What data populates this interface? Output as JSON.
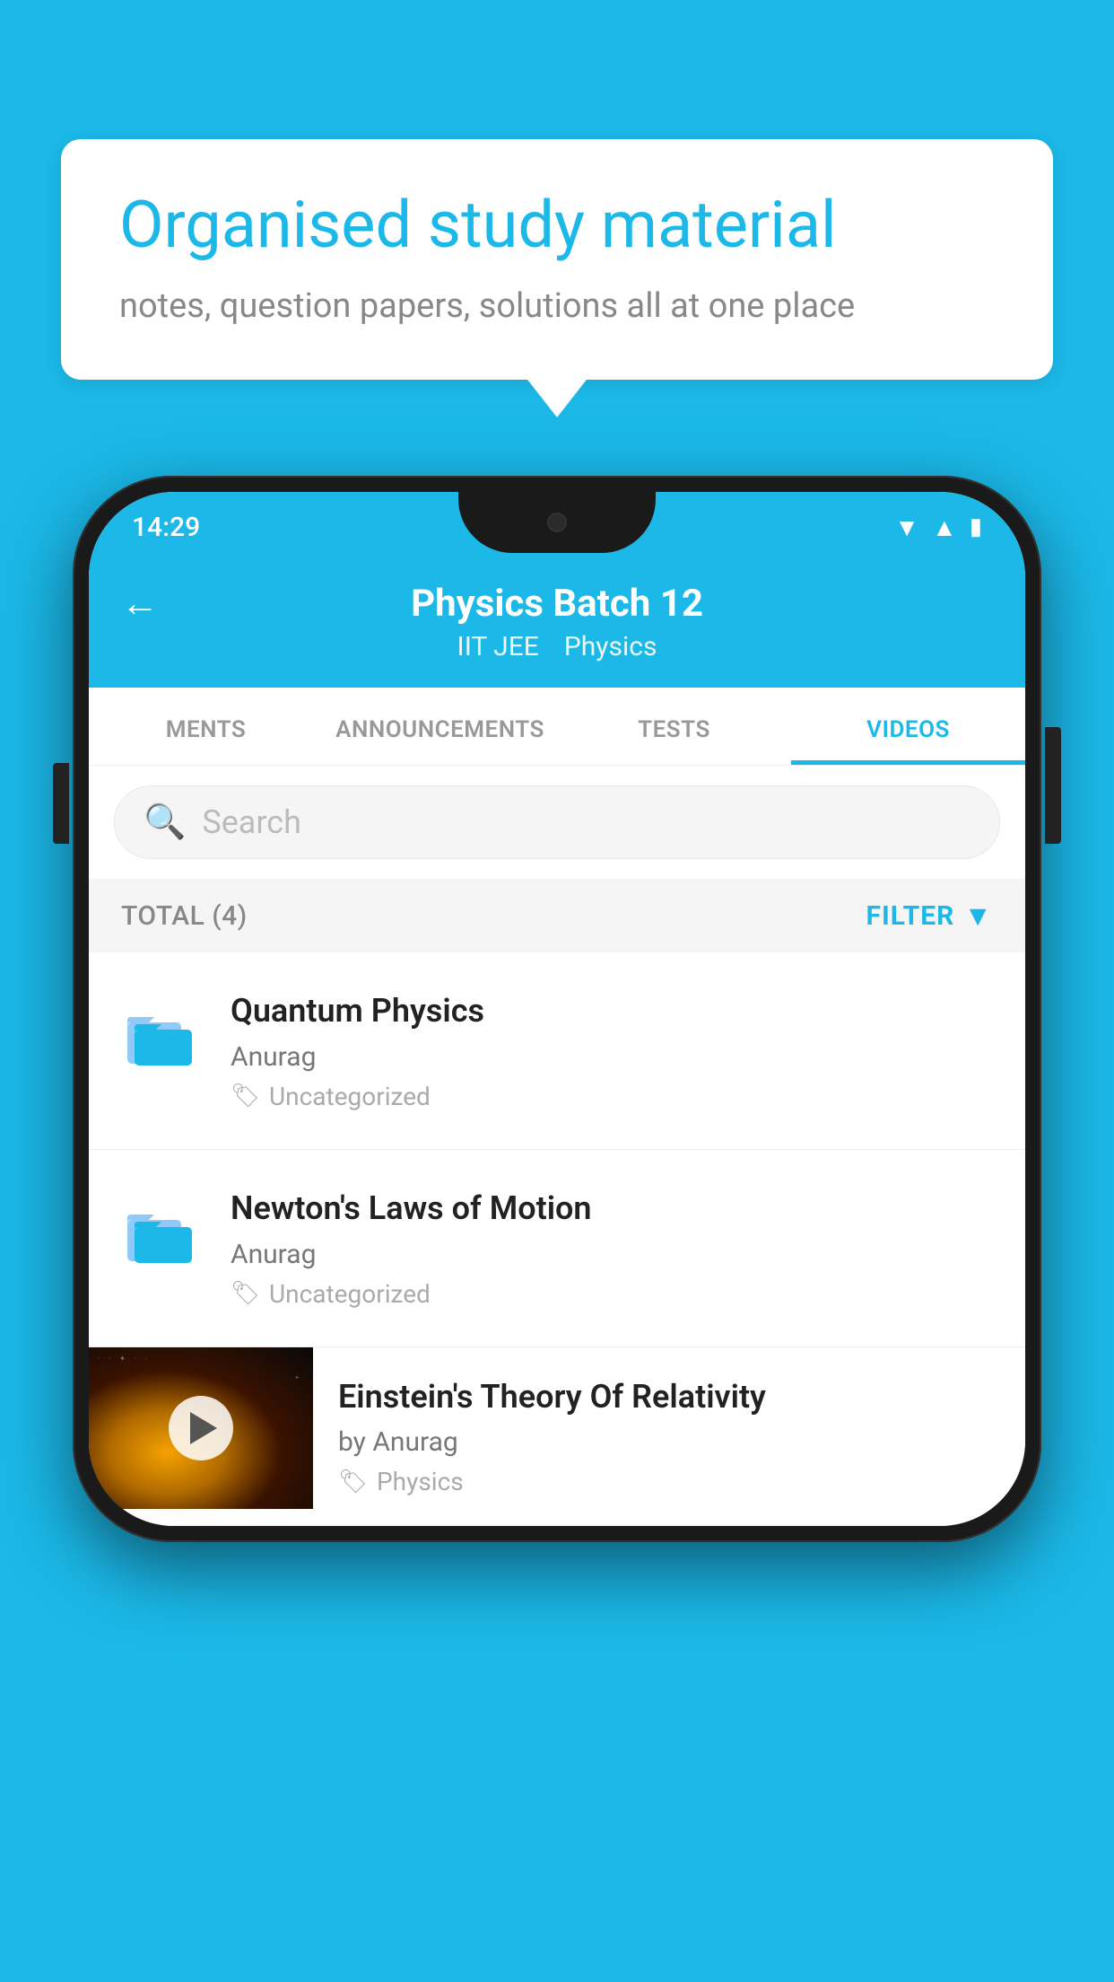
{
  "background_color": "#1bb8e8",
  "bubble": {
    "title": "Organised study material",
    "subtitle": "notes, question papers, solutions all at one place"
  },
  "status_bar": {
    "time": "14:29",
    "wifi": "▼",
    "signal": "▲",
    "battery": "▮"
  },
  "app_bar": {
    "title": "Physics Batch 12",
    "tag1": "IIT JEE",
    "tag2": "Physics",
    "back_label": "←"
  },
  "tabs": [
    {
      "label": "MENTS",
      "active": false
    },
    {
      "label": "ANNOUNCEMENTS",
      "active": false
    },
    {
      "label": "TESTS",
      "active": false
    },
    {
      "label": "VIDEOS",
      "active": true
    }
  ],
  "search": {
    "placeholder": "Search"
  },
  "filter_bar": {
    "total_label": "TOTAL (4)",
    "filter_label": "FILTER"
  },
  "video_items": [
    {
      "title": "Quantum Physics",
      "author": "Anurag",
      "tag": "Uncategorized",
      "type": "folder"
    },
    {
      "title": "Newton's Laws of Motion",
      "author": "Anurag",
      "tag": "Uncategorized",
      "type": "folder"
    },
    {
      "title": "Einstein's Theory Of Relativity",
      "author": "by Anurag",
      "tag": "Physics",
      "type": "video"
    }
  ]
}
